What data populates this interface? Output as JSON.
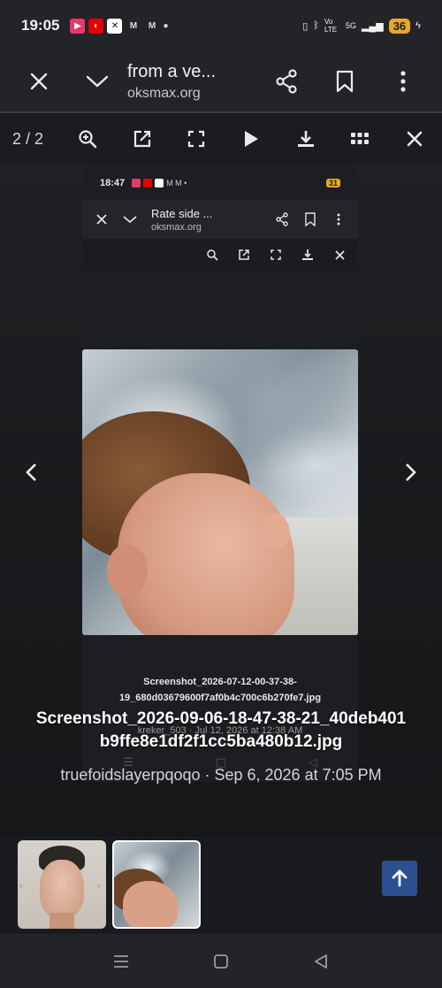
{
  "status": {
    "time": "19:05",
    "battery": "36",
    "network": "5G",
    "volte": "Vo LTE"
  },
  "appbar": {
    "title": "from a ve...",
    "url": "oksmax.org"
  },
  "lightbox": {
    "counter": "2 / 2"
  },
  "inner": {
    "time": "18:47",
    "battery": "31",
    "title": "Rate side ...",
    "url": "oksmax.org",
    "caption": "Screenshot_2026-07-12-00-37-38-19_680d03679600f7af0b4c700c6b270fe7.jpg",
    "meta": "kreker_503 · Jul 12, 2026 at 12:38 AM"
  },
  "caption": {
    "filename": "Screenshot_2026-09-06-18-47-38-21_40deb401b9ffe8e1df2f1cc5ba480b12.jpg",
    "meta": "truefoidslayerpqoqo · Sep 6, 2026 at 7:05 PM"
  },
  "colors": {
    "accent": "#2b4f8f",
    "battery": "#e9a826",
    "background": "#1a1c1f"
  }
}
